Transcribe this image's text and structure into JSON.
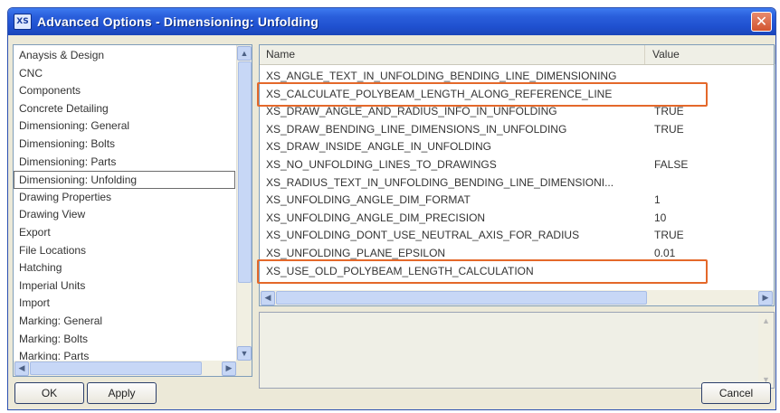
{
  "window": {
    "title": "Advanced Options - Dimensioning: Unfolding",
    "close_glyph": "✕",
    "app_icon": "XS"
  },
  "categories": [
    {
      "label": "Anaysis & Design",
      "selected": false
    },
    {
      "label": "CNC",
      "selected": false
    },
    {
      "label": "Components",
      "selected": false
    },
    {
      "label": "Concrete Detailing",
      "selected": false
    },
    {
      "label": "Dimensioning: General",
      "selected": false
    },
    {
      "label": "Dimensioning: Bolts",
      "selected": false
    },
    {
      "label": "Dimensioning: Parts",
      "selected": false
    },
    {
      "label": "Dimensioning: Unfolding",
      "selected": true
    },
    {
      "label": "Drawing Properties",
      "selected": false
    },
    {
      "label": "Drawing View",
      "selected": false
    },
    {
      "label": "Export",
      "selected": false
    },
    {
      "label": "File Locations",
      "selected": false
    },
    {
      "label": "Hatching",
      "selected": false
    },
    {
      "label": "Imperial Units",
      "selected": false
    },
    {
      "label": "Import",
      "selected": false
    },
    {
      "label": "Marking: General",
      "selected": false
    },
    {
      "label": "Marking: Bolts",
      "selected": false
    },
    {
      "label": "Marking: Parts",
      "selected": false
    }
  ],
  "table": {
    "col_name": "Name",
    "col_value": "Value",
    "rows": [
      {
        "name": "XS_ANGLE_TEXT_IN_UNFOLDING_BENDING_LINE_DIMENSIONING",
        "value": ""
      },
      {
        "name": "XS_CALCULATE_POLYBEAM_LENGTH_ALONG_REFERENCE_LINE",
        "value": ""
      },
      {
        "name": "XS_DRAW_ANGLE_AND_RADIUS_INFO_IN_UNFOLDING",
        "value": "TRUE"
      },
      {
        "name": "XS_DRAW_BENDING_LINE_DIMENSIONS_IN_UNFOLDING",
        "value": "TRUE"
      },
      {
        "name": "XS_DRAW_INSIDE_ANGLE_IN_UNFOLDING",
        "value": ""
      },
      {
        "name": "XS_NO_UNFOLDING_LINES_TO_DRAWINGS",
        "value": "FALSE"
      },
      {
        "name": "XS_RADIUS_TEXT_IN_UNFOLDING_BENDING_LINE_DIMENSIONI...",
        "value": ""
      },
      {
        "name": "XS_UNFOLDING_ANGLE_DIM_FORMAT",
        "value": "1"
      },
      {
        "name": "XS_UNFOLDING_ANGLE_DIM_PRECISION",
        "value": "10"
      },
      {
        "name": "XS_UNFOLDING_DONT_USE_NEUTRAL_AXIS_FOR_RADIUS",
        "value": "TRUE"
      },
      {
        "name": "XS_UNFOLDING_PLANE_EPSILON",
        "value": "0.01"
      },
      {
        "name": "XS_USE_OLD_POLYBEAM_LENGTH_CALCULATION",
        "value": ""
      }
    ],
    "highlighted_rows": [
      1,
      11
    ],
    "highlight_color": "#e4682a"
  },
  "buttons": {
    "ok": "OK",
    "apply": "Apply",
    "cancel": "Cancel"
  }
}
